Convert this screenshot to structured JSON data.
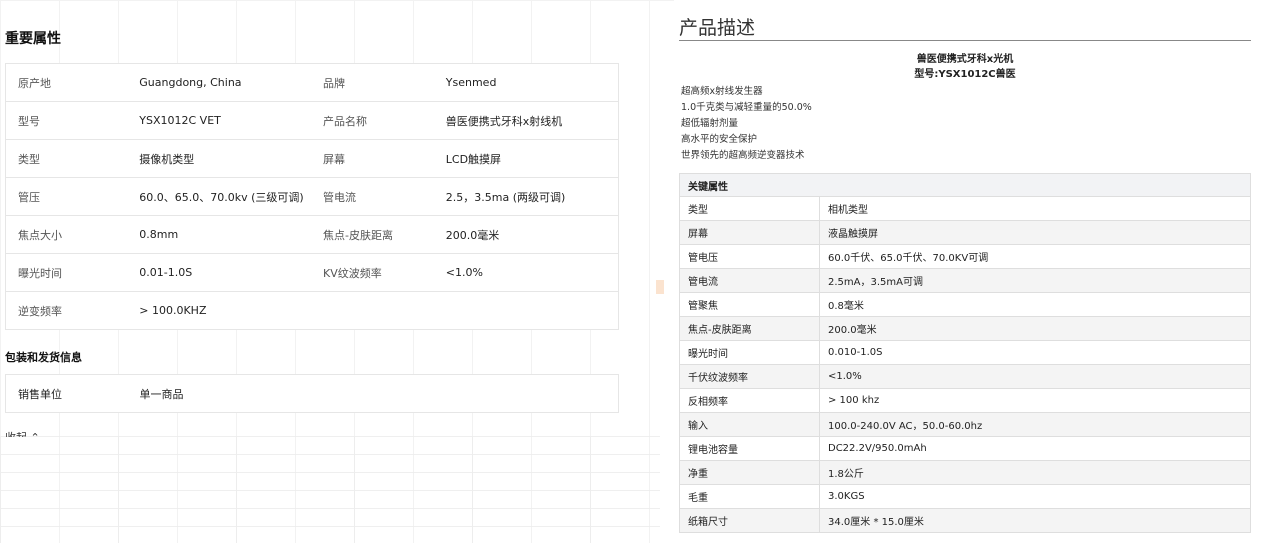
{
  "important": {
    "title": "重要属性",
    "rows": [
      [
        {
          "k": "原产地",
          "v": "Guangdong, China"
        },
        {
          "k": "品牌",
          "v": "Ysenmed"
        }
      ],
      [
        {
          "k": "型号",
          "v": "YSX1012C VET"
        },
        {
          "k": "产品名称",
          "v": "兽医便携式牙科x射线机"
        }
      ],
      [
        {
          "k": "类型",
          "v": "摄像机类型"
        },
        {
          "k": "屏幕",
          "v": "LCD触摸屏"
        }
      ],
      [
        {
          "k": "管压",
          "v": "60.0、65.0、70.0kv (三级可调)"
        },
        {
          "k": "管电流",
          "v": "2.5，3.5ma (两级可调)"
        }
      ],
      [
        {
          "k": "焦点大小",
          "v": "0.8mm"
        },
        {
          "k": "焦点-皮肤距离",
          "v": "200.0毫米"
        }
      ],
      [
        {
          "k": "曝光时间",
          "v": "0.01-1.0S"
        },
        {
          "k": "KV纹波频率",
          "v": "<1.0%"
        }
      ],
      [
        {
          "k": "逆变频率",
          "v": "> 100.0KHZ"
        },
        {
          "k": "",
          "v": ""
        }
      ]
    ]
  },
  "packaging": {
    "title": "包装和发货信息",
    "rows": [
      {
        "k": "销售单位",
        "v": "单一商品"
      }
    ]
  },
  "collapse_label": "收起 ⌃",
  "description": {
    "title": "产品描述",
    "name_line1": "兽医便携式牙科x光机",
    "name_line2": "型号:YSX1012C兽医",
    "features": [
      "超高频x射线发生器",
      "1.0千克类与减轻重量的50.0%",
      "超低辐射剂量",
      "高水平的安全保护",
      "世界领先的超高频逆变器技术"
    ],
    "key_title": "关键属性",
    "key_rows": [
      {
        "k": "类型",
        "v": "相机类型"
      },
      {
        "k": "屏幕",
        "v": "液晶触摸屏"
      },
      {
        "k": "管电压",
        "v": "60.0千伏、65.0千伏、70.0KV可调"
      },
      {
        "k": "管电流",
        "v": "2.5mA，3.5mA可调"
      },
      {
        "k": "管聚焦",
        "v": "0.8毫米"
      },
      {
        "k": "焦点-皮肤距离",
        "v": "200.0毫米"
      },
      {
        "k": "曝光时间",
        "v": "0.010-1.0S"
      },
      {
        "k": "千伏纹波频率",
        "v": "<1.0%"
      },
      {
        "k": "反相频率",
        "v": "> 100 khz"
      },
      {
        "k": "输入",
        "v": "100.0-240.0V AC，50.0-60.0hz"
      },
      {
        "k": "锂电池容量",
        "v": "DC22.2V/950.0mAh"
      },
      {
        "k": "净重",
        "v": "1.8公斤"
      },
      {
        "k": "毛重",
        "v": "3.0KGS"
      },
      {
        "k": "纸箱尺寸",
        "v": "34.0厘米 * 15.0厘米"
      }
    ]
  }
}
